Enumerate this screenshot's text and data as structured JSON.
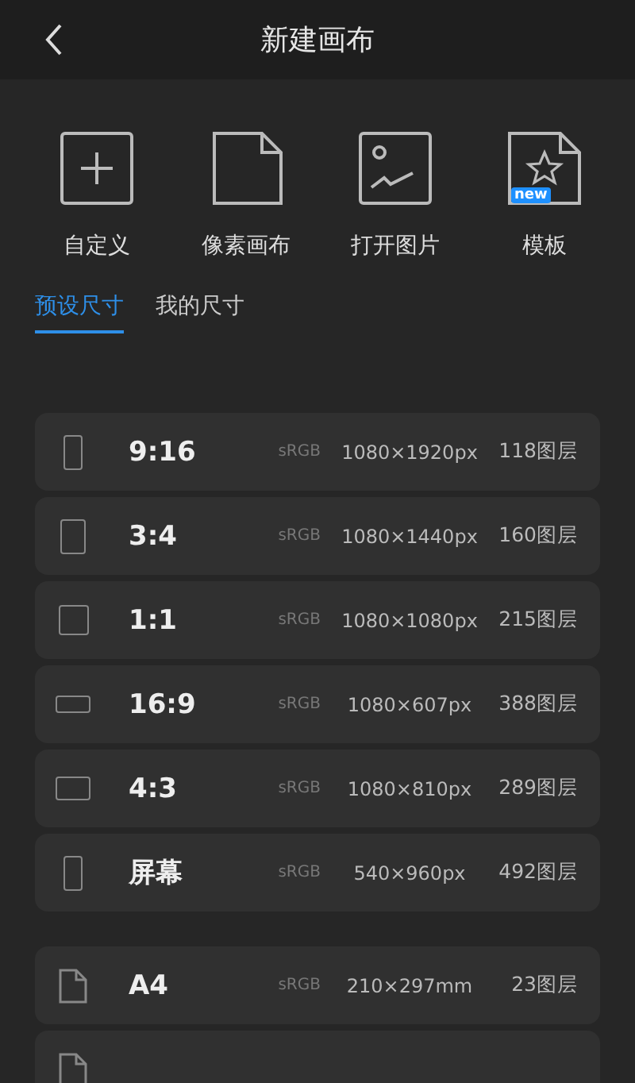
{
  "header": {
    "title": "新建画布"
  },
  "actions": [
    {
      "kind": "plus",
      "label": "自定义"
    },
    {
      "kind": "page",
      "label": "像素画布"
    },
    {
      "kind": "image",
      "label": "打开图片"
    },
    {
      "kind": "template",
      "label": "模板",
      "badge": "new"
    }
  ],
  "tabs": [
    {
      "label": "预设尺寸",
      "selected": true
    },
    {
      "label": "我的尺寸",
      "selected": false
    }
  ],
  "presets": [
    {
      "kind": "tall",
      "name": "9:16",
      "color_space": "sRGB",
      "size": "1080×1920px",
      "layers": "118图层"
    },
    {
      "kind": "portrait",
      "name": "3:4",
      "color_space": "sRGB",
      "size": "1080×1440px",
      "layers": "160图层"
    },
    {
      "kind": "square",
      "name": "1:1",
      "color_space": "sRGB",
      "size": "1080×1080px",
      "layers": "215图层"
    },
    {
      "kind": "wide",
      "name": "16:9",
      "color_space": "sRGB",
      "size": "1080×607px",
      "layers": "388图层"
    },
    {
      "kind": "landscape",
      "name": "4:3",
      "color_space": "sRGB",
      "size": "1080×810px",
      "layers": "289图层"
    },
    {
      "kind": "tall",
      "name": "屏幕",
      "color_space": "sRGB",
      "size": "540×960px",
      "layers": "492图层"
    }
  ],
  "paper_sizes": [
    {
      "kind": "document",
      "name": "A4",
      "color_space": "sRGB",
      "size": "210×297mm",
      "layers": "23图层"
    },
    {
      "kind": "document"
    }
  ]
}
